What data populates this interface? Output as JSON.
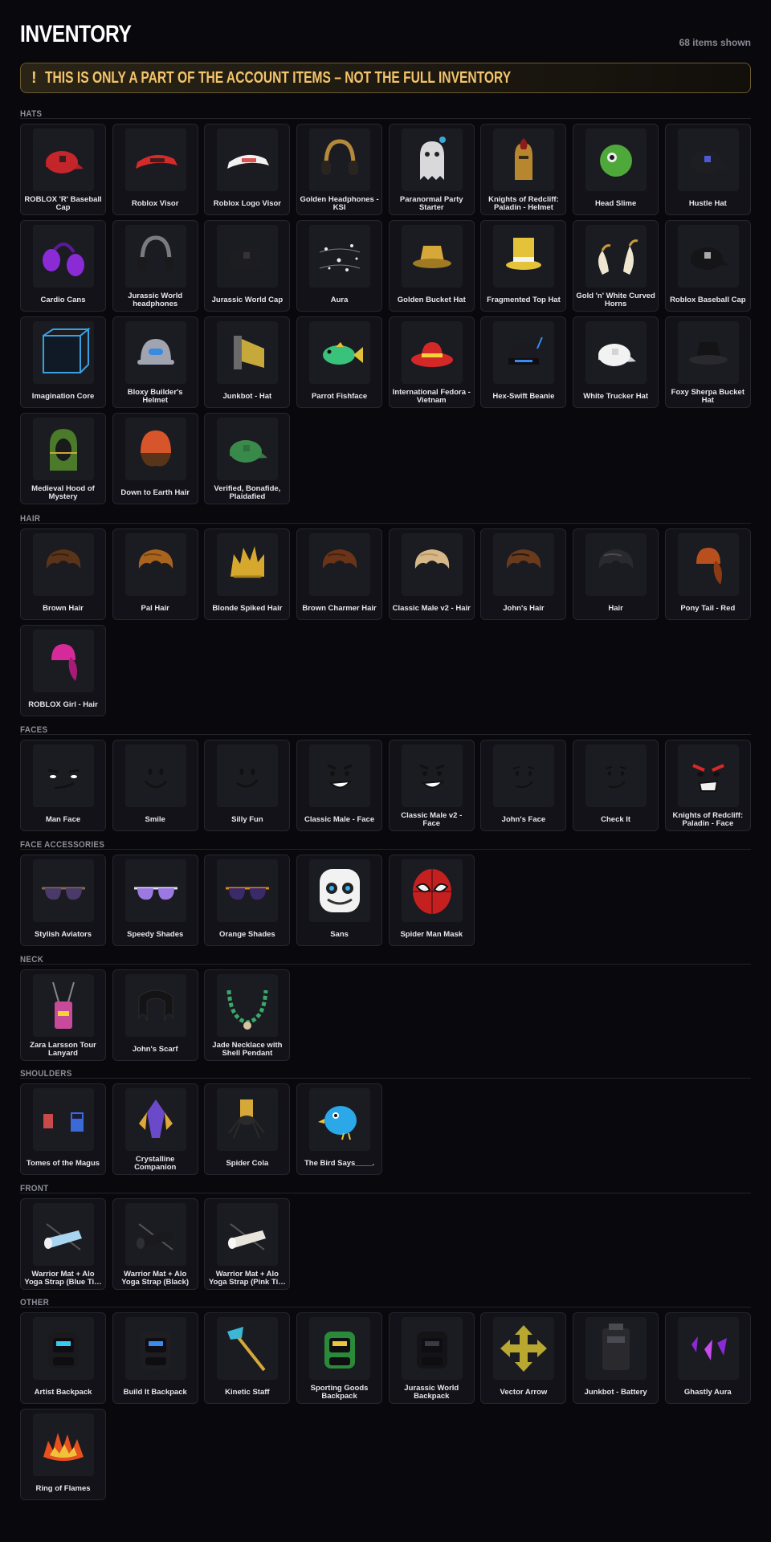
{
  "header": {
    "title": "INVENTORY",
    "count": "68 items shown"
  },
  "banner": {
    "icon": "!",
    "text": "THIS IS ONLY A PART OF THE ACCOUNT ITEMS – NOT THE FULL INVENTORY"
  },
  "sections": [
    {
      "title": "HATS",
      "items": [
        {
          "name": "ROBLOX 'R' Baseball Cap",
          "icon": "cap",
          "color": "#c4262b",
          "accent": "#1a1a1a"
        },
        {
          "name": "Roblox Visor",
          "icon": "visor",
          "color": "#d42a2a",
          "accent": "#1a1a1a"
        },
        {
          "name": "Roblox Logo Visor",
          "icon": "visor",
          "color": "#f1f1f1",
          "accent": "#d42a2a"
        },
        {
          "name": "Golden Headphones - KSI",
          "icon": "headphones",
          "color": "#2a2420",
          "accent": "#b48a3a"
        },
        {
          "name": "Paranormal Party Starter",
          "icon": "ghost",
          "color": "#d9d9dc",
          "accent": "#3aa7d9"
        },
        {
          "name": "Knights of Redcliff: Paladin - Helmet",
          "icon": "helmet",
          "color": "#b8862e",
          "accent": "#8a1c1c"
        },
        {
          "name": "Head Slime",
          "icon": "slime",
          "color": "#4fa83a",
          "accent": "#1a1a1a"
        },
        {
          "name": "Hustle Hat",
          "icon": "cap",
          "color": "#1d1d22",
          "accent": "#5a6cff"
        },
        {
          "name": "Cardio Cans",
          "icon": "earmuffs",
          "color": "#8a2bd6",
          "accent": "#5a1a9a"
        },
        {
          "name": "Jurassic World headphones",
          "icon": "headphones",
          "color": "#1a1a1d",
          "accent": "#7a7a80"
        },
        {
          "name": "Jurassic World Cap",
          "icon": "cap",
          "color": "#1d1d21",
          "accent": "#3a3a40"
        },
        {
          "name": "Aura",
          "icon": "sparkles",
          "color": "#e8e8e8",
          "accent": "#bbbbbb"
        },
        {
          "name": "Golden Bucket Hat",
          "icon": "bucket",
          "color": "#d6a83a",
          "accent": "#a07a22"
        },
        {
          "name": "Fragmented Top Hat",
          "icon": "tophat",
          "color": "#e4c23a",
          "accent": "#f3f3f3"
        },
        {
          "name": "Gold 'n' White Curved Horns",
          "icon": "horns",
          "color": "#efe6cf",
          "accent": "#c89a3a"
        },
        {
          "name": "Roblox Baseball Cap",
          "icon": "cap",
          "color": "#151518",
          "accent": "#cfcfcf"
        },
        {
          "name": "Imagination Core",
          "icon": "cube",
          "color": "#0f1a26",
          "accent": "#3aa0e0"
        },
        {
          "name": "Bloxy Builder's Helmet",
          "icon": "hardhat",
          "color": "#a0a4b0",
          "accent": "#3a8ae0"
        },
        {
          "name": "Junkbot - Hat",
          "icon": "junk",
          "color": "#c7a83a",
          "accent": "#6a6a6a"
        },
        {
          "name": "Parrot Fishface",
          "icon": "fish",
          "color": "#39c27a",
          "accent": "#e0c23a"
        },
        {
          "name": "International Fedora - Vietnam",
          "icon": "fedora",
          "color": "#d42828",
          "accent": "#f0d23a"
        },
        {
          "name": "Hex-Swift Beanie",
          "icon": "beanie",
          "color": "#1a1a20",
          "accent": "#3a8af0"
        },
        {
          "name": "White Trucker Hat",
          "icon": "cap",
          "color": "#f2f2f2",
          "accent": "#cccccc"
        },
        {
          "name": "Foxy Sherpa Bucket Hat",
          "icon": "bucket",
          "color": "#141416",
          "accent": "#2a2a2e"
        },
        {
          "name": "Medieval Hood of Mystery",
          "icon": "hood",
          "color": "#4a7a2a",
          "accent": "#c8a83a"
        },
        {
          "name": "Down to Earth Hair",
          "icon": "beaniehair",
          "color": "#d6552a",
          "accent": "#5a3418"
        },
        {
          "name": "Verified, Bonafide, Plaidafied",
          "icon": "cap",
          "color": "#3a8a4a",
          "accent": "#2a6a3a"
        }
      ]
    },
    {
      "title": "HAIR",
      "items": [
        {
          "name": "Brown Hair",
          "icon": "hair",
          "color": "#5a3418",
          "accent": "#3a2010"
        },
        {
          "name": "Pal Hair",
          "icon": "hair",
          "color": "#a8641e",
          "accent": "#7a4412"
        },
        {
          "name": "Blonde Spiked Hair",
          "icon": "spikyhair",
          "color": "#d6a82e",
          "accent": "#a8801e"
        },
        {
          "name": "Brown Charmer Hair",
          "icon": "hair",
          "color": "#6a3418",
          "accent": "#4a2210"
        },
        {
          "name": "Classic Male v2 - Hair",
          "icon": "hair",
          "color": "#d6b888",
          "accent": "#b8986a"
        },
        {
          "name": "John's Hair",
          "icon": "hair",
          "color": "#6a3a1c",
          "accent": "#2a1a0e"
        },
        {
          "name": "Hair",
          "icon": "hair",
          "color": "#2a2a2e",
          "accent": "#4a4a50"
        },
        {
          "name": "Pony Tail - Red",
          "icon": "ponytail",
          "color": "#b8501e",
          "accent": "#8a3a14"
        },
        {
          "name": "ROBLOX Girl - Hair",
          "icon": "ponytail",
          "color": "#d62a9a",
          "accent": "#a81a78"
        }
      ]
    },
    {
      "title": "FACES",
      "items": [
        {
          "name": "Man Face",
          "icon": "face-man",
          "color": "#111111",
          "accent": "#ffffff"
        },
        {
          "name": "Smile",
          "icon": "face-smile",
          "color": "#111111",
          "accent": "#ffffff"
        },
        {
          "name": "Silly Fun",
          "icon": "face-silly",
          "color": "#111111",
          "accent": "#ffffff"
        },
        {
          "name": "Classic Male - Face",
          "icon": "face-grin",
          "color": "#111111",
          "accent": "#ffffff"
        },
        {
          "name": "Classic Male v2 - Face",
          "icon": "face-grin",
          "color": "#111111",
          "accent": "#ffffff"
        },
        {
          "name": "John's Face",
          "icon": "face-smirk",
          "color": "#111111",
          "accent": "#ffffff"
        },
        {
          "name": "Check It",
          "icon": "face-smirk",
          "color": "#111111",
          "accent": "#ffffff"
        },
        {
          "name": "Knights of Redcliff: Paladin - Face",
          "icon": "face-angry",
          "color": "#111111",
          "accent": "#d62a2a"
        }
      ]
    },
    {
      "title": "FACE ACCESSORIES",
      "items": [
        {
          "name": "Stylish Aviators",
          "icon": "glasses",
          "color": "#4a3a6a",
          "accent": "#8a6a4a"
        },
        {
          "name": "Speedy Shades",
          "icon": "glasses",
          "color": "#9a7ae0",
          "accent": "#e0e0f0"
        },
        {
          "name": "Orange Shades",
          "icon": "glasses",
          "color": "#3a2a6a",
          "accent": "#d6841e"
        },
        {
          "name": "Sans",
          "icon": "skull",
          "color": "#f2f2f2",
          "accent": "#3ab0f0"
        },
        {
          "name": "Spider Man Mask",
          "icon": "spidermask",
          "color": "#c42020",
          "accent": "#f2f2f2"
        }
      ]
    },
    {
      "title": "NECK",
      "items": [
        {
          "name": "Zara Larsson Tour Lanyard",
          "icon": "lanyard",
          "color": "#c84a9a",
          "accent": "#f0d23a"
        },
        {
          "name": "John's Scarf",
          "icon": "scarf",
          "color": "#141416",
          "accent": "#2a2a2e"
        },
        {
          "name": "Jade Necklace with Shell Pendant",
          "icon": "necklace",
          "color": "#3aa86a",
          "accent": "#d6c4a0"
        }
      ]
    },
    {
      "title": "SHOULDERS",
      "items": [
        {
          "name": "Tomes of the Magus",
          "icon": "tomes",
          "color": "#3a6ad6",
          "accent": "#c84a4a"
        },
        {
          "name": "Crystalline Companion",
          "icon": "crystal",
          "color": "#6a4ac8",
          "accent": "#e0a83a"
        },
        {
          "name": "Spider Cola",
          "icon": "spider",
          "color": "#d6a83a",
          "accent": "#2a2a2a"
        },
        {
          "name": "The Bird Says____.",
          "icon": "bird",
          "color": "#2aa8e8",
          "accent": "#e8c23a"
        }
      ]
    },
    {
      "title": "FRONT",
      "items": [
        {
          "name": "Warrior Mat + Alo Yoga Strap (Blue Ti…",
          "icon": "yogamat",
          "color": "#a8d6f0",
          "accent": "#f0f0f0"
        },
        {
          "name": "Warrior Mat + Alo Yoga Strap (Black)",
          "icon": "yogamat",
          "color": "#1a1a1e",
          "accent": "#2e2e34"
        },
        {
          "name": "Warrior Mat + Alo Yoga Strap (Pink Ti…",
          "icon": "yogamat",
          "color": "#e8e4dc",
          "accent": "#f6f6f6"
        }
      ]
    },
    {
      "title": "OTHER",
      "items": [
        {
          "name": "Artist Backpack",
          "icon": "backpack",
          "color": "#1a1a1e",
          "accent": "#3ac8f0"
        },
        {
          "name": "Build It Backpack",
          "icon": "backpack",
          "color": "#1e1e22",
          "accent": "#3a8af0"
        },
        {
          "name": "Kinetic Staff",
          "icon": "staff",
          "color": "#3ab8d6",
          "accent": "#d6a83a"
        },
        {
          "name": "Sporting Goods Backpack",
          "icon": "backpack",
          "color": "#2a8a3a",
          "accent": "#e8c83a"
        },
        {
          "name": "Jurassic World Backpack",
          "icon": "backpack",
          "color": "#141416",
          "accent": "#3a3a40"
        },
        {
          "name": "Vector Arrow",
          "icon": "arrows",
          "color": "#b8a830",
          "accent": "#8a7e22"
        },
        {
          "name": "Junkbot - Battery",
          "icon": "battery",
          "color": "#2a2a2e",
          "accent": "#4a4a52"
        },
        {
          "name": "Ghastly Aura",
          "icon": "ghastly",
          "color": "#8a2ad6",
          "accent": "#c84af0"
        },
        {
          "name": "Ring of Flames",
          "icon": "flames",
          "color": "#e8501e",
          "accent": "#f0c23a"
        }
      ]
    }
  ]
}
